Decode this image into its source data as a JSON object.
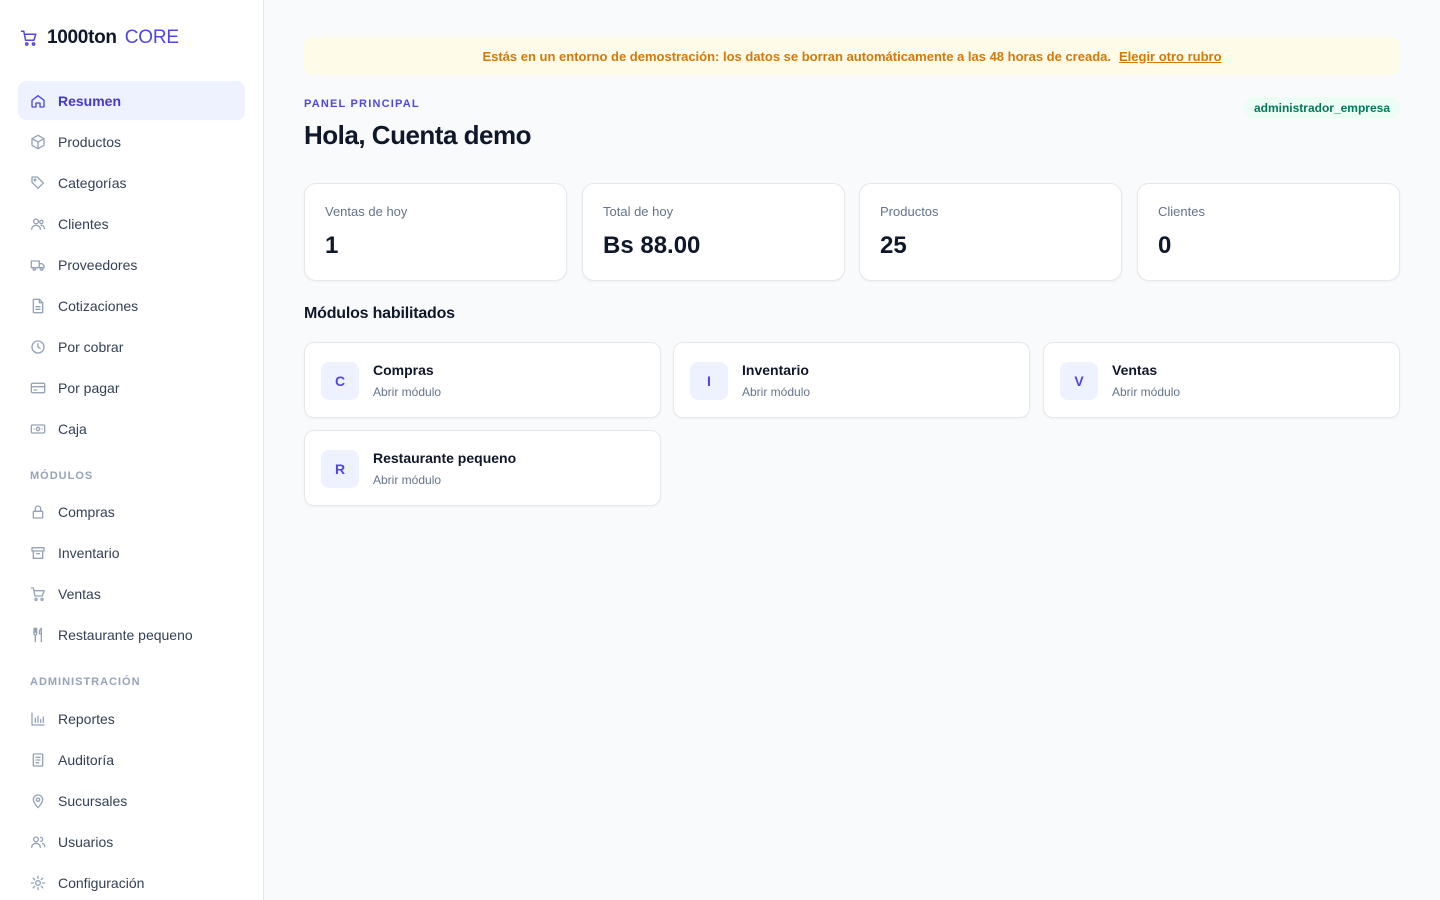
{
  "brand": {
    "name": "1000ton",
    "suffix": "CORE",
    "icon": "cart-icon"
  },
  "colors": {
    "accent": "#4f46e5",
    "warning": "#d97706",
    "success": "#047857"
  },
  "sidebar": {
    "main_items": [
      {
        "label": "Resumen",
        "icon": "home-icon",
        "active": true
      },
      {
        "label": "Productos",
        "icon": "box-icon"
      },
      {
        "label": "Categorías",
        "icon": "tag-icon"
      },
      {
        "label": "Clientes",
        "icon": "users-icon"
      },
      {
        "label": "Proveedores",
        "icon": "truck-icon"
      },
      {
        "label": "Cotizaciones",
        "icon": "document-icon"
      },
      {
        "label": "Por cobrar",
        "icon": "clock-icon"
      },
      {
        "label": "Por pagar",
        "icon": "credit-card-icon"
      },
      {
        "label": "Caja",
        "icon": "cash-icon"
      }
    ],
    "modules_title": "MÓDULOS",
    "module_items": [
      {
        "label": "Compras",
        "icon": "lock-icon"
      },
      {
        "label": "Inventario",
        "icon": "archive-icon"
      },
      {
        "label": "Ventas",
        "icon": "cart-icon"
      },
      {
        "label": "Restaurante pequeno",
        "icon": "utensils-icon"
      }
    ],
    "admin_title": "ADMINISTRACIÓN",
    "admin_items": [
      {
        "label": "Reportes",
        "icon": "bar-chart-icon"
      },
      {
        "label": "Auditoría",
        "icon": "clipboard-icon"
      },
      {
        "label": "Sucursales",
        "icon": "map-pin-icon"
      },
      {
        "label": "Usuarios",
        "icon": "user-group-icon"
      },
      {
        "label": "Configuración",
        "icon": "sun-gear-icon"
      }
    ]
  },
  "banner": {
    "text": "Estás en un entorno de demostración: los datos se borran automáticamente a las 48 horas de creada.",
    "link": "Elegir otro rubro"
  },
  "header": {
    "eyebrow": "PANEL PRINCIPAL",
    "greeting": "Hola, Cuenta demo",
    "role": "administrador_empresa"
  },
  "stats": [
    {
      "label": "Ventas de hoy",
      "value": "1"
    },
    {
      "label": "Total de hoy",
      "value": "Bs 88.00"
    },
    {
      "label": "Productos",
      "value": "25"
    },
    {
      "label": "Clientes",
      "value": "0"
    }
  ],
  "modules": {
    "title": "Módulos habilitados",
    "items": [
      {
        "letter": "C",
        "name": "Compras",
        "action": "Abrir módulo"
      },
      {
        "letter": "I",
        "name": "Inventario",
        "action": "Abrir módulo"
      },
      {
        "letter": "V",
        "name": "Ventas",
        "action": "Abrir módulo"
      },
      {
        "letter": "R",
        "name": "Restaurante pequeno",
        "action": "Abrir módulo"
      }
    ]
  }
}
